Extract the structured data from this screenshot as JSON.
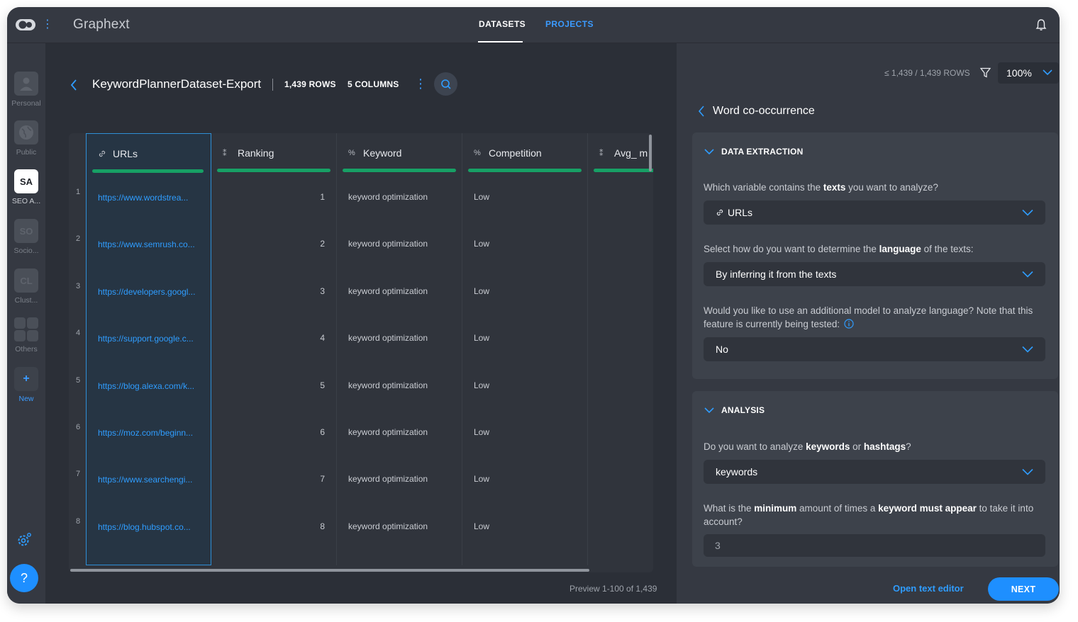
{
  "app": {
    "title": "Graphext"
  },
  "nav": {
    "tabs": [
      {
        "label": "DATASETS",
        "active": true
      },
      {
        "label": "PROJECTS",
        "active": false
      }
    ]
  },
  "rail": {
    "items": [
      {
        "label": "Personal",
        "badge": "",
        "icon": "user-icon"
      },
      {
        "label": "Public",
        "badge": "",
        "icon": "globe-icon"
      },
      {
        "label": "SEO A...",
        "badge": "SA",
        "active": true
      },
      {
        "label": "Socio...",
        "badge": "SO"
      },
      {
        "label": "Clust...",
        "badge": "CL"
      },
      {
        "label": "Others",
        "badge": "",
        "icon": "grid-icon"
      },
      {
        "label": "New",
        "badge": "+"
      }
    ],
    "help_label": "?"
  },
  "dataset": {
    "title": "KeywordPlannerDataset-Export",
    "rows": "1,439 ROWS",
    "columns": "5 COLUMNS"
  },
  "table": {
    "columns": [
      {
        "icon": "link-icon",
        "glyph": "🔗",
        "title": "URLs"
      },
      {
        "icon": "number-icon",
        "glyph": "⁑",
        "title": "Ranking"
      },
      {
        "icon": "category-icon",
        "glyph": "%",
        "title": "Keyword"
      },
      {
        "icon": "category-icon",
        "glyph": "%",
        "title": "Competition"
      },
      {
        "icon": "number-icon",
        "glyph": "⁑",
        "title": "Avg_ m"
      }
    ],
    "rows": [
      {
        "num": "1",
        "url": "https://www.wordstrea...",
        "ranking": "1",
        "keyword": "keyword optimization",
        "competition": "Low"
      },
      {
        "num": "2",
        "url": "https://www.semrush.co...",
        "ranking": "2",
        "keyword": "keyword optimization",
        "competition": "Low"
      },
      {
        "num": "3",
        "url": "https://developers.googl...",
        "ranking": "3",
        "keyword": "keyword optimization",
        "competition": "Low"
      },
      {
        "num": "4",
        "url": "https://support.google.c...",
        "ranking": "4",
        "keyword": "keyword optimization",
        "competition": "Low"
      },
      {
        "num": "5",
        "url": "https://blog.alexa.com/k...",
        "ranking": "5",
        "keyword": "keyword optimization",
        "competition": "Low"
      },
      {
        "num": "6",
        "url": "https://moz.com/beginn...",
        "ranking": "6",
        "keyword": "keyword optimization",
        "competition": "Low"
      },
      {
        "num": "7",
        "url": "https://www.searchengi...",
        "ranking": "7",
        "keyword": "keyword optimization",
        "competition": "Low"
      },
      {
        "num": "8",
        "url": "https://blog.hubspot.co...",
        "ranking": "8",
        "keyword": "keyword optimization",
        "competition": "Low"
      }
    ],
    "preview": "Preview 1-100 of 1,439"
  },
  "right_panel": {
    "filter_info": "≤ 1,439 / 1,439 ROWS",
    "zoom": "100%",
    "title": "Word co-occurrence",
    "data_extraction": {
      "title": "DATA EXTRACTION",
      "q1": {
        "pre": "Which variable contains the ",
        "bold": "texts",
        "post": " you want to analyze?"
      },
      "q1_value": "URLs",
      "q2": {
        "pre": "Select how do you want to determine the ",
        "bold": "language",
        "post": " of the texts:"
      },
      "q2_value": "By inferring it from the texts",
      "q3": "Would you like to use an additional model to analyze language? Note that this feature is currently being tested:",
      "q3_value": "No"
    },
    "analysis": {
      "title": "ANALYSIS",
      "q1": {
        "pre": "Do you want to analyze ",
        "b1": "keywords",
        "mid": " or ",
        "b2": "hashtags",
        "post": "?"
      },
      "q1_value": "keywords",
      "q2": {
        "pre": "What is the ",
        "b1": "minimum",
        "mid": " amount of times a ",
        "b2": "keyword must appear",
        "post": " to take it into account?"
      },
      "q2_value": "3"
    },
    "open_editor": "Open text editor",
    "next": "NEXT"
  },
  "colors": {
    "accent": "#1e8fff",
    "link": "#2f9dff",
    "quality_bar": "#17a065",
    "background": "#2b2f37",
    "panel": "#353942"
  }
}
